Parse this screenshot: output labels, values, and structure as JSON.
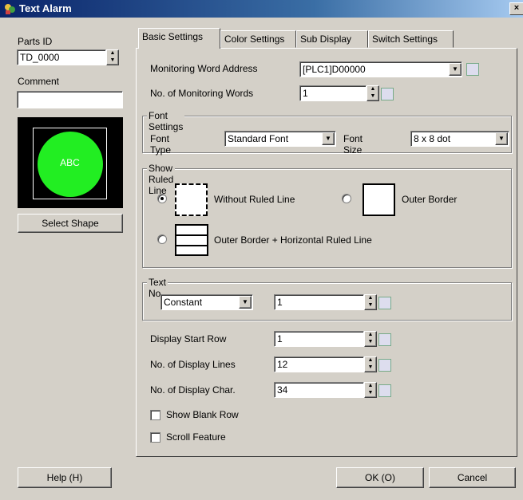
{
  "window": {
    "title": "Text Alarm",
    "close_label": "×"
  },
  "left": {
    "parts_id_label": "Parts ID",
    "parts_id_value": "TD_0000",
    "comment_label": "Comment",
    "comment_value": "",
    "preview_text": "ABC",
    "select_shape_label": "Select Shape",
    "help_label": "Help (H)"
  },
  "tabs": [
    {
      "label": "Basic Settings"
    },
    {
      "label": "Color Settings"
    },
    {
      "label": "Sub Display"
    },
    {
      "label": "Switch Settings"
    }
  ],
  "basic": {
    "monitor_addr_label": "Monitoring Word Address",
    "monitor_addr_value": "[PLC1]D00000",
    "num_words_label": "No. of Monitoring Words",
    "num_words_value": "1",
    "font_group": "Font Settings",
    "font_type_label": "Font Type",
    "font_type_value": "Standard Font",
    "font_size_label": "Font Size",
    "font_size_value": "8 x 8 dot",
    "ruled_group": "Show Ruled Line",
    "ruled_opt1": "Without Ruled Line",
    "ruled_opt2": "Outer Border",
    "ruled_opt3": "Outer Border + Horizontal Ruled Line",
    "textno_group": "Text No.",
    "textno_mode": "Constant",
    "textno_value": "1",
    "start_row_label": "Display Start Row",
    "start_row_value": "1",
    "num_lines_label": "No. of Display Lines",
    "num_lines_value": "12",
    "num_chars_label": "No. of Display Char.",
    "num_chars_value": "34",
    "blank_row_label": "Show Blank Row",
    "scroll_label": "Scroll Feature"
  },
  "footer": {
    "ok_label": "OK (O)",
    "cancel_label": "Cancel"
  },
  "colors": {
    "preview_circle": "#22ee22",
    "title_bar": "#0a246a"
  },
  "state": {
    "ruled_selected": "Without Ruled Line",
    "show_blank_row": false,
    "scroll_feature": false
  }
}
